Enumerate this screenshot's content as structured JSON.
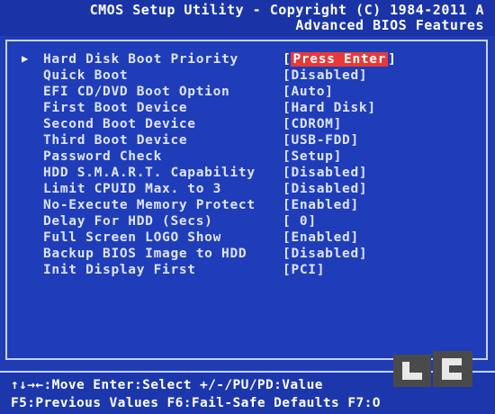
{
  "header": {
    "title": "CMOS Setup Utility - Copyright (C) 1984-2011 A",
    "subtitle": "Advanced BIOS Features"
  },
  "menu": {
    "selected_marker": "▶",
    "items": [
      {
        "label": "Hard Disk Boot Priority",
        "value": "Press Enter"
      },
      {
        "label": "Quick Boot",
        "value": "Disabled"
      },
      {
        "label": "EFI CD/DVD Boot Option",
        "value": "Auto"
      },
      {
        "label": "First Boot Device",
        "value": "Hard Disk"
      },
      {
        "label": "Second Boot Device",
        "value": "CDROM"
      },
      {
        "label": "Third Boot Device",
        "value": "USB-FDD"
      },
      {
        "label": "Password Check",
        "value": "Setup"
      },
      {
        "label": "HDD S.M.A.R.T. Capability",
        "value": "Disabled"
      },
      {
        "label": "Limit CPUID Max. to 3",
        "value": "Disabled"
      },
      {
        "label": "No-Execute Memory Protect",
        "value": "Enabled"
      },
      {
        "label": "Delay For HDD (Secs)",
        "value": " 0"
      },
      {
        "label": "Full Screen LOGO Show",
        "value": "Enabled"
      },
      {
        "label": "Backup BIOS Image to HDD",
        "value": "Disabled"
      },
      {
        "label": "Init Display First",
        "value": "PCI"
      }
    ]
  },
  "footer": {
    "line1": "↑↓→←:Move  Enter:Select  +/-/PU/PD:Value",
    "line2": "F5:Previous Values  F6:Fail-Safe Defaults  F7:O"
  },
  "colors": {
    "background": "#1e3cb4",
    "highlight": "#e63a3a",
    "text": "#e8ecff"
  }
}
